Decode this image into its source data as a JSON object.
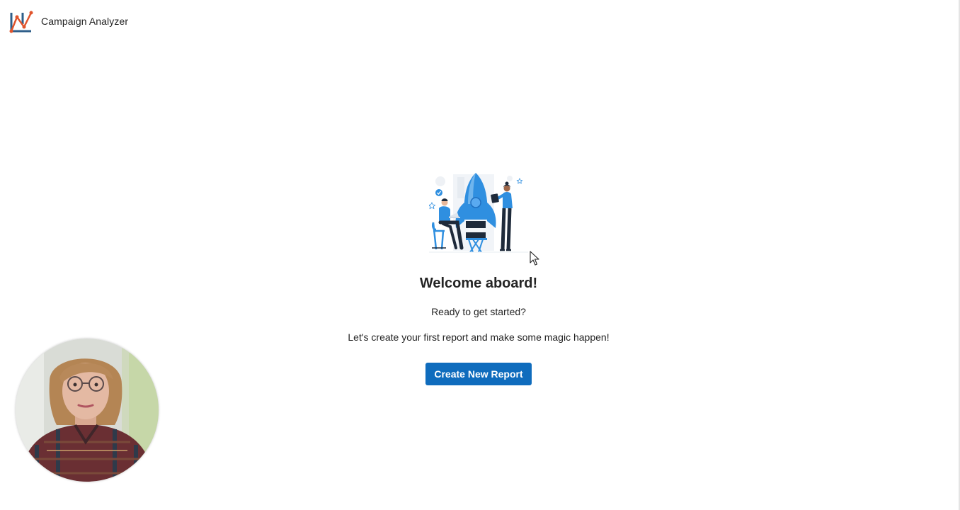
{
  "header": {
    "app_title": "Campaign Analyzer",
    "logo_icon": "line-chart-logo-icon",
    "logo_colors": {
      "frame": "#2f5f8a",
      "line": "#e0542c"
    }
  },
  "main": {
    "illustration_icon": "rocket-team-illustration",
    "title": "Welcome aboard!",
    "subtitle": "Ready to get started?",
    "message": "Let's create your first report and make some magic happen!",
    "primary_button_label": "Create New Report"
  },
  "theme": {
    "accent": "#0f6cbd",
    "illustration_blue": "#2f8fe0",
    "illustration_dark": "#1e2a3a"
  },
  "overlay": {
    "webcam_icon": "webcam-presenter-avatar",
    "cursor_icon": "mouse-pointer-icon"
  }
}
